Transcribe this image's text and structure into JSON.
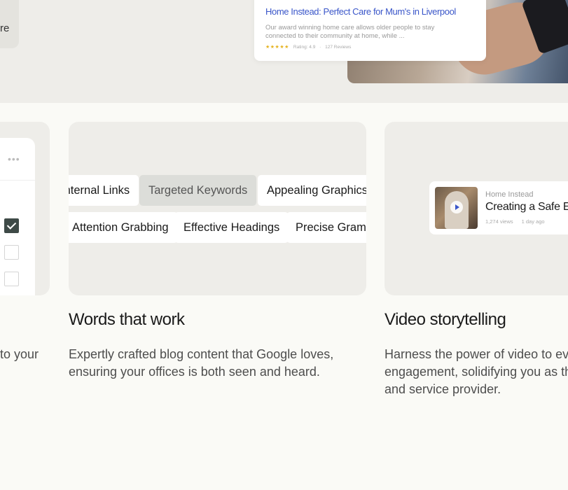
{
  "top": {
    "left_card_fragment": "re",
    "search_result": {
      "title": "Home Instead: Perfect Care for Mum's in Liverpool",
      "description": "Our award winning home care allows older people to stay connected to their community at home, while ...",
      "stars": "★★★★★",
      "rating": "Rating: 4.9",
      "separator": "·",
      "reviews": "127 Reviews"
    }
  },
  "left_card": {
    "menu_dots": "•••",
    "checkboxes": [
      true,
      false,
      false
    ]
  },
  "keywords_card": {
    "row1": [
      "Internal Links",
      "Targeted Keywords",
      "Appealing Graphics"
    ],
    "row2": [
      "Attention Grabbing",
      "Effective Headings",
      "Precise Grammar"
    ],
    "active": "Targeted Keywords"
  },
  "video_card": {
    "channel": "Home Instead",
    "title": "Creating a Safe Environment",
    "views": "1,274 views",
    "age": "1 day ago"
  },
  "sections": {
    "left": {
      "body_line2": "to your"
    },
    "words": {
      "heading": "Words that work",
      "body_line1": "Expertly crafted blog content that Google loves,",
      "body_line2": "ensuring your offices is both seen and heard."
    },
    "video": {
      "heading": "Video storytelling",
      "body_line1": "Harness the power of video to evolve",
      "body_line2": "engagement, solidifying you as the",
      "body_line3": "and service provider."
    }
  },
  "colors": {
    "background": "#FAFAF6",
    "card": "#EEEDE9",
    "link_blue": "#3A56C9",
    "checkbox_on": "#3E4A47",
    "star": "#E5B321"
  }
}
